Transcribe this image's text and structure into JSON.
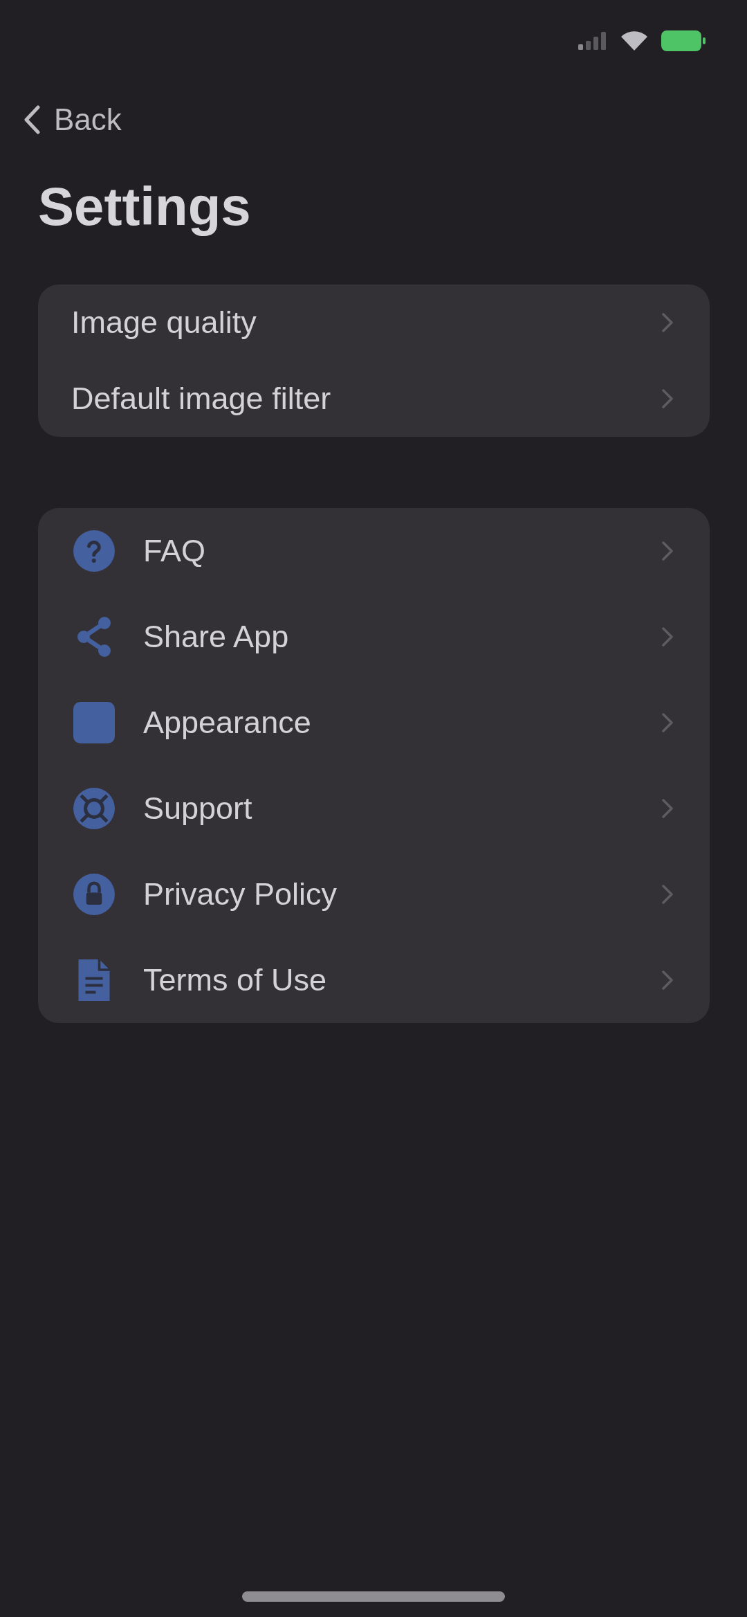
{
  "nav": {
    "back_label": "Back"
  },
  "title": "Settings",
  "groups": [
    {
      "kind": "plain",
      "items": [
        {
          "label": "Image quality"
        },
        {
          "label": "Default image filter"
        }
      ]
    },
    {
      "kind": "with_icons",
      "items": [
        {
          "label": "FAQ"
        },
        {
          "label": "Share App"
        },
        {
          "label": "Appearance"
        },
        {
          "label": "Support"
        },
        {
          "label": "Privacy Policy"
        },
        {
          "label": "Terms of Use"
        }
      ]
    }
  ]
}
